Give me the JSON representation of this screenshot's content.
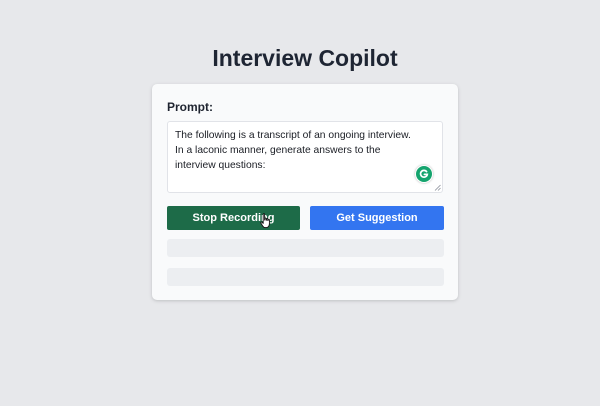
{
  "app": {
    "title": "Interview Copilot"
  },
  "prompt": {
    "label": "Prompt:",
    "value": "The following is a transcript of an ongoing interview. In a laconic manner, generate answers to the interview questions:"
  },
  "buttons": {
    "stop_recording": "Stop Recording",
    "get_suggestion": "Get Suggestion"
  },
  "outputs": [
    {
      "text": ""
    },
    {
      "text": ""
    }
  ],
  "icons": {
    "grammarly": "grammarly-icon",
    "cursor": "hand-pointer-icon"
  },
  "colors": {
    "background": "#e7e8eb",
    "card": "#f9fafb",
    "stop_button": "#1d6b48",
    "suggest_button": "#3375f0",
    "grammarly": "#15a46e"
  }
}
